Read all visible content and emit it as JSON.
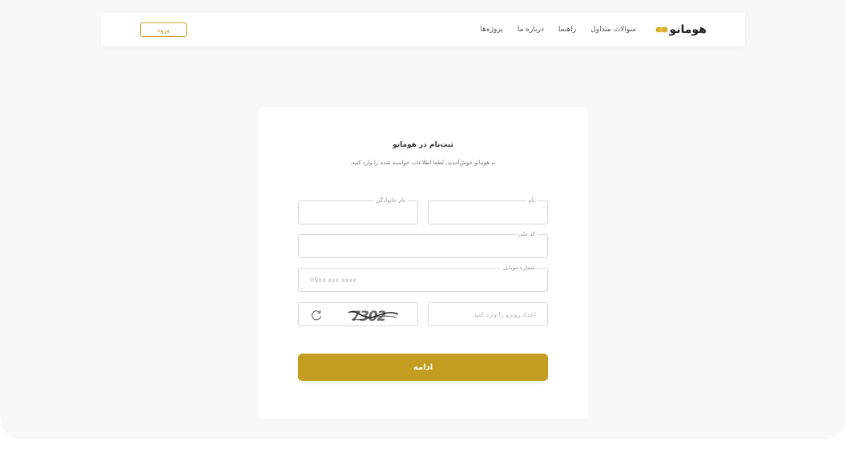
{
  "header": {
    "login_label": "ورود",
    "nav": [
      "پروژه‌ها",
      "درباره ما",
      "راهنما",
      "سوالات متداول"
    ],
    "logo_text": "هومانو",
    "brand_color": "#c9a227"
  },
  "form": {
    "title": "ثبت‌نام در هومانو",
    "subtitle": "به هومانو خوش‌آمدید، لطفا اطلاعات خواسته شده را وارد کنید.",
    "first_name_label": "نام",
    "last_name_label": "نام خانوادگی",
    "national_code_label": "کد ملی",
    "mobile_label": "شماره موبایل",
    "mobile_placeholder": "09xx xxx xxxx",
    "captcha_placeholder": "اعداد روبرو را وارد کنید",
    "captcha_code": "7302",
    "submit_label": "ادامه",
    "submit_color": "#c29d20"
  }
}
